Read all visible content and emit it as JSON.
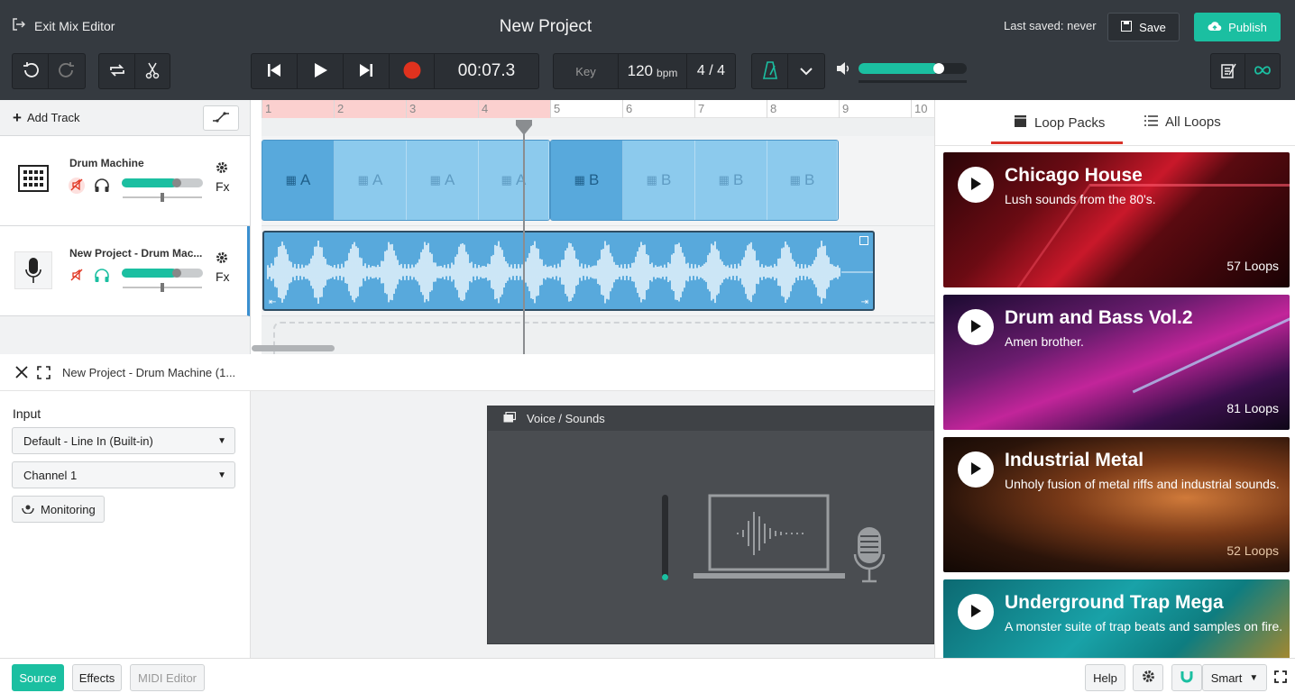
{
  "header": {
    "exit_label": "Exit Mix Editor",
    "project_title": "New Project",
    "last_saved": "Last saved: never",
    "save_label": "Save",
    "publish_label": "Publish",
    "time": "00:07.3",
    "key_label": "Key",
    "bpm_value": "120",
    "bpm_unit": "bpm",
    "time_signature": "4 / 4",
    "volume_level": 0.74
  },
  "tracks": {
    "add_track_label": "Add Track",
    "items": [
      {
        "name": "Drum Machine",
        "volume": 0.68,
        "fx_label": "Fx"
      },
      {
        "name": "New Project - Drum Mac...",
        "volume": 0.68,
        "fx_label": "Fx"
      }
    ]
  },
  "timeline": {
    "bars": [
      "1",
      "2",
      "3",
      "4",
      "5",
      "6",
      "7",
      "8",
      "9",
      "10"
    ],
    "pattern_a": "A",
    "pattern_b": "B"
  },
  "editor": {
    "track_title": "New Project - Drum Machine (1...",
    "input_label": "Input",
    "input_value": "Default - Line In (Built-in)",
    "channel_value": "Channel 1",
    "monitoring_label": "Monitoring",
    "voice_panel_title": "Voice / Sounds"
  },
  "loops": {
    "tab_packs": "Loop Packs",
    "tab_all": "All Loops",
    "cards": [
      {
        "name": "Chicago House",
        "desc": "Lush sounds from the 80's.",
        "count": "57 Loops"
      },
      {
        "name": "Drum and Bass Vol.2",
        "desc": "Amen brother.",
        "count": "81 Loops"
      },
      {
        "name": "Industrial Metal",
        "desc": "Unholy fusion of metal riffs and industrial sounds.",
        "count": "52 Loops"
      },
      {
        "name": "Underground Trap Mega",
        "desc": "A monster suite of trap beats and samples on fire.",
        "count": ""
      }
    ]
  },
  "footer": {
    "source_label": "Source",
    "effects_label": "Effects",
    "midi_label": "MIDI Editor",
    "help_label": "Help",
    "mode_label": "Smart"
  },
  "colors": {
    "accent": "#1bbfa1",
    "toolbar": "#353a40",
    "clip": "#5aaee0",
    "record": "#e0321e"
  }
}
